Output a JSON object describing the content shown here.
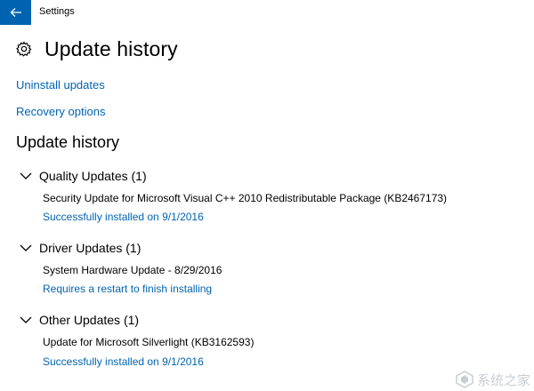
{
  "window": {
    "title": "Settings",
    "accent": "#0063b1"
  },
  "header": {
    "title": "Update history",
    "icon": "gear-icon"
  },
  "links": {
    "uninstall": "Uninstall updates",
    "recovery": "Recovery options"
  },
  "history": {
    "title": "Update history",
    "groups": [
      {
        "label": "Quality Updates (1)",
        "items": [
          {
            "name": "Security Update for Microsoft Visual C++ 2010 Redistributable Package (KB2467173)",
            "status": "Successfully installed on 9/1/2016"
          }
        ]
      },
      {
        "label": "Driver Updates (1)",
        "items": [
          {
            "name": "System Hardware Update - 8/29/2016",
            "status": "Requires a restart to finish installing"
          }
        ]
      },
      {
        "label": "Other Updates (1)",
        "items": [
          {
            "name": "Update for Microsoft Silverlight (KB3162593)",
            "status": "Successfully installed on 9/1/2016"
          }
        ]
      }
    ]
  },
  "watermark": {
    "text": "系统之家"
  }
}
